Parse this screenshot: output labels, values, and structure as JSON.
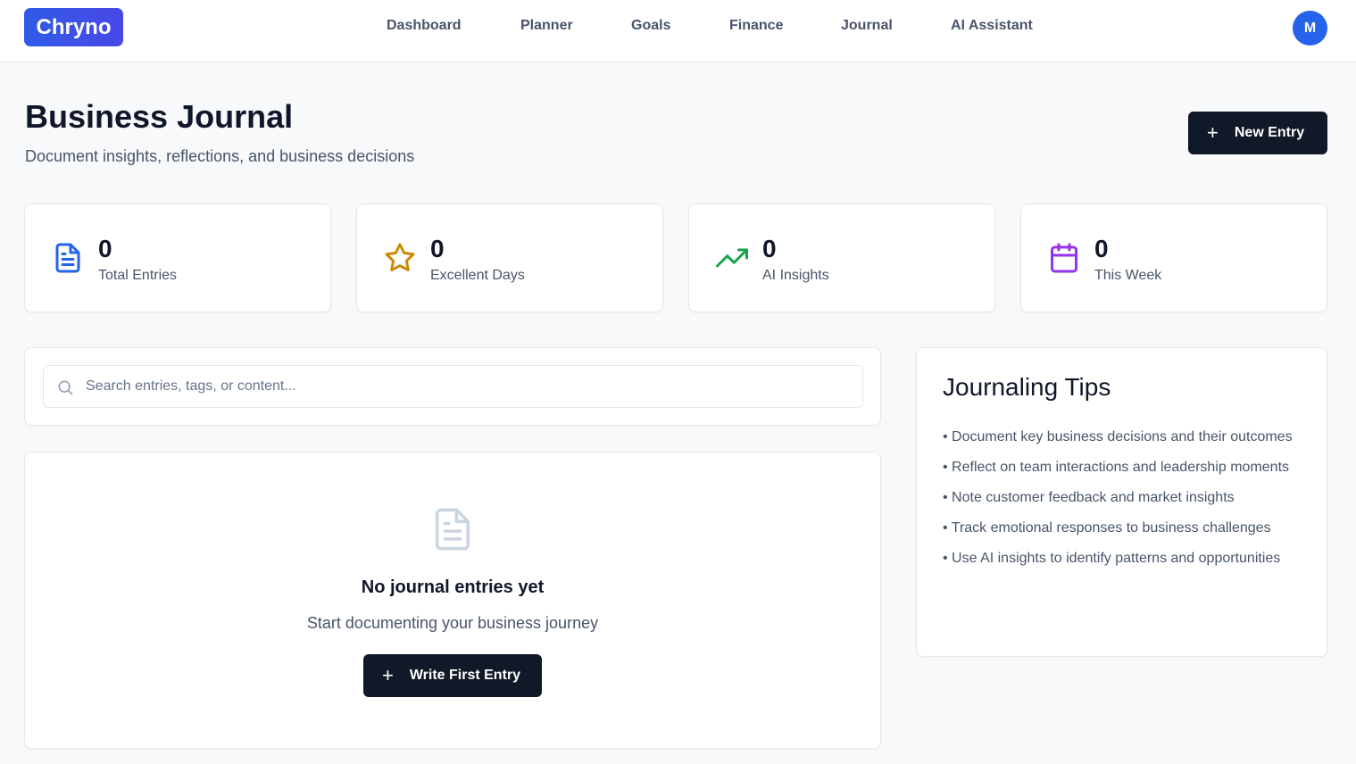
{
  "app": {
    "logo": "Chryno",
    "avatar_initial": "M"
  },
  "nav": {
    "items": [
      {
        "label": "Dashboard"
      },
      {
        "label": "Planner"
      },
      {
        "label": "Goals"
      },
      {
        "label": "Finance"
      },
      {
        "label": "Journal"
      },
      {
        "label": "AI Assistant"
      }
    ]
  },
  "header": {
    "title": "Business Journal",
    "subtitle": "Document insights, reflections, and business decisions",
    "new_entry_label": "New Entry"
  },
  "stats": [
    {
      "value": "0",
      "label": "Total Entries",
      "icon": "document-icon",
      "color": "#2563eb"
    },
    {
      "value": "0",
      "label": "Excellent Days",
      "icon": "star-icon",
      "color": "#ca8a04"
    },
    {
      "value": "0",
      "label": "AI Insights",
      "icon": "trending-up-icon",
      "color": "#16a34a"
    },
    {
      "value": "0",
      "label": "This Week",
      "icon": "calendar-icon",
      "color": "#9333ea"
    }
  ],
  "search": {
    "placeholder": "Search entries, tags, or content...",
    "value": ""
  },
  "empty_state": {
    "title": "No journal entries yet",
    "subtitle": "Start documenting your business journey",
    "button_label": "Write First Entry"
  },
  "tips": {
    "title": "Journaling Tips",
    "items": [
      "• Document key business decisions and their outcomes",
      "• Reflect on team interactions and leadership moments",
      "• Note customer feedback and market insights",
      "• Track emotional responses to business challenges",
      "• Use AI insights to identify patterns and opportunities"
    ]
  },
  "colors": {
    "accent": "#2563eb",
    "dark_button": "#111827",
    "background": "#f8f9fb"
  }
}
